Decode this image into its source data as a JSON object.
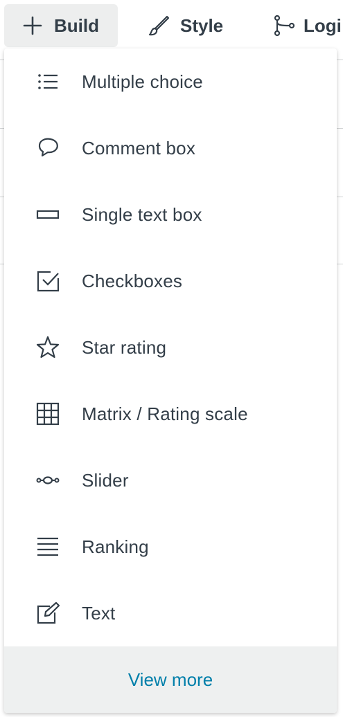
{
  "toolbar": {
    "tabs": [
      {
        "label": "Build",
        "icon": "plus-icon",
        "active": true
      },
      {
        "label": "Style",
        "icon": "brush-icon",
        "active": false
      },
      {
        "label": "Logi",
        "icon": "branch-icon",
        "active": false
      }
    ]
  },
  "menu": {
    "items": [
      {
        "label": "Multiple choice",
        "icon": "list-icon"
      },
      {
        "label": "Comment box",
        "icon": "speech-bubble-icon"
      },
      {
        "label": "Single text box",
        "icon": "text-box-icon"
      },
      {
        "label": "Checkboxes",
        "icon": "checkbox-icon"
      },
      {
        "label": "Star rating",
        "icon": "star-icon"
      },
      {
        "label": "Matrix / Rating scale",
        "icon": "grid-icon"
      },
      {
        "label": "Slider",
        "icon": "slider-icon"
      },
      {
        "label": "Ranking",
        "icon": "ranking-icon"
      },
      {
        "label": "Text",
        "icon": "edit-icon"
      }
    ],
    "footer_label": "View more"
  },
  "colors": {
    "text": "#333e48",
    "link": "#007faa",
    "active_tab_bg": "#edeeee",
    "footer_bg": "#eef0f0"
  }
}
